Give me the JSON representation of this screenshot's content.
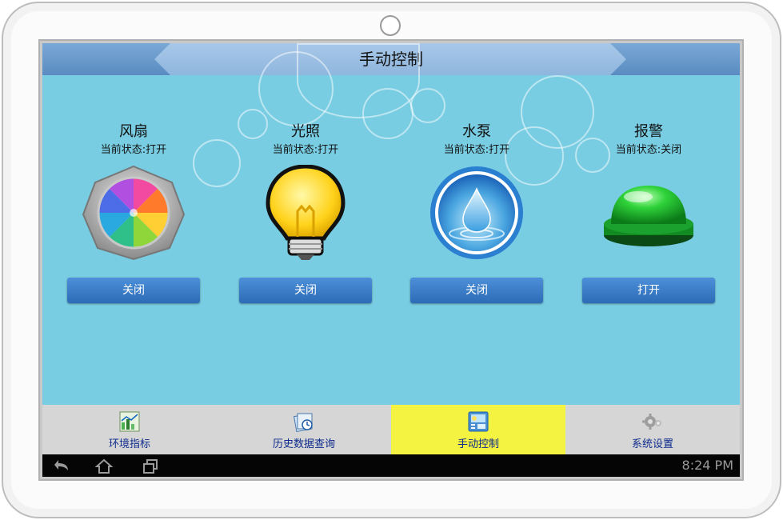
{
  "window": {
    "title": "手动控制"
  },
  "devices": [
    {
      "name": "风扇",
      "status": "当前状态:打开",
      "button_label": "关闭",
      "icon": "fan-icon"
    },
    {
      "name": "光照",
      "status": "当前状态:打开",
      "button_label": "关闭",
      "icon": "light-bulb-icon"
    },
    {
      "name": "水泵",
      "status": "当前状态:打开",
      "button_label": "关闭",
      "icon": "water-drop-icon"
    },
    {
      "name": "报警",
      "status": "当前状态:关闭",
      "button_label": "打开",
      "icon": "alarm-button-icon"
    }
  ],
  "tabs": [
    {
      "label": "环境指标",
      "icon": "chart-icon",
      "active": false
    },
    {
      "label": "历史数据查询",
      "icon": "history-icon",
      "active": false
    },
    {
      "label": "手动控制",
      "icon": "control-panel-icon",
      "active": true
    },
    {
      "label": "系统设置",
      "icon": "gear-icon",
      "active": false
    }
  ],
  "navbar": {
    "time": "8:24 PM",
    "icons": [
      "back-icon",
      "home-icon",
      "recent-apps-icon"
    ]
  },
  "colors": {
    "background": "#79cde2",
    "header": "#6b9bcc",
    "button": "#3d7dc8",
    "active_tab": "#f4f341",
    "tab_label": "#0d2a8c"
  }
}
